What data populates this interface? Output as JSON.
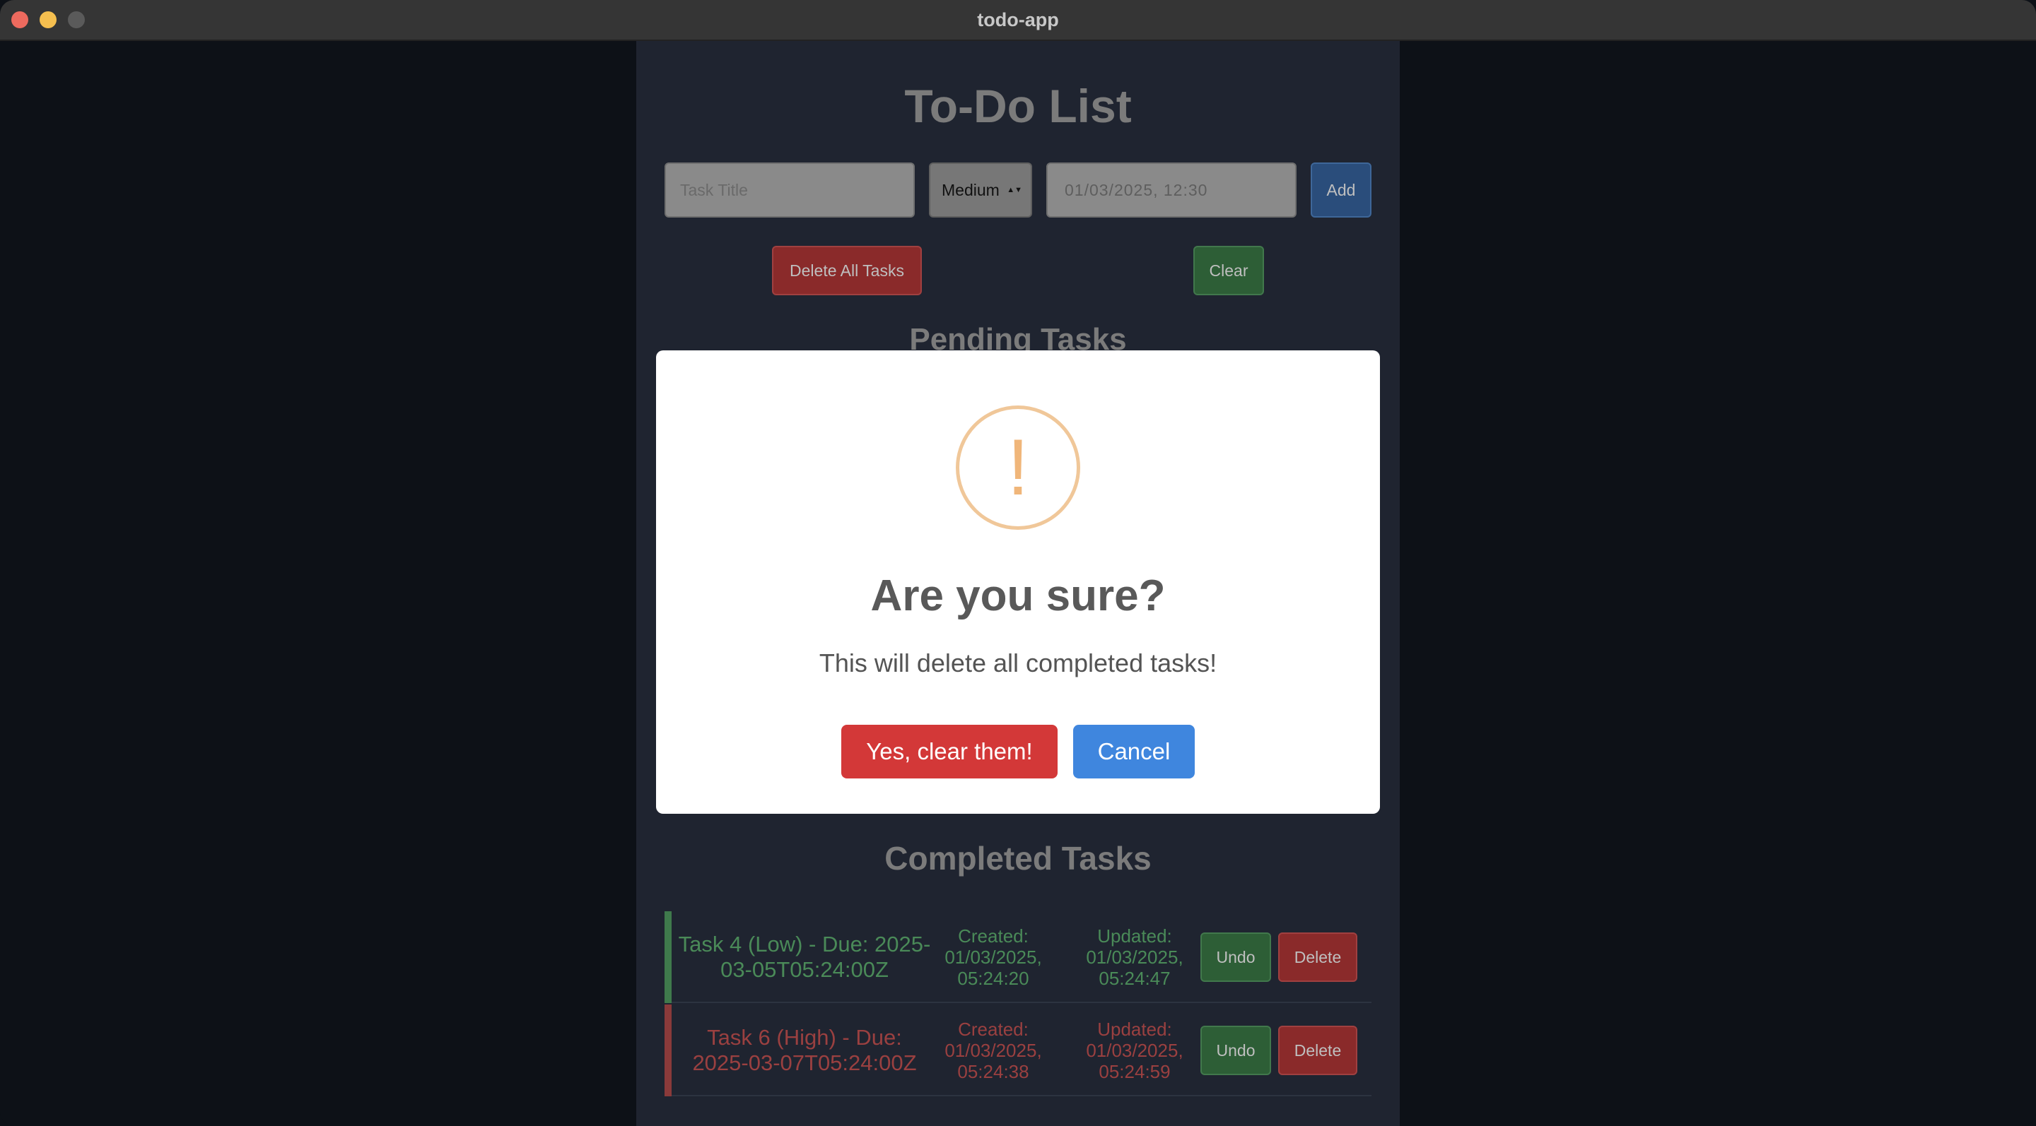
{
  "window": {
    "title": "todo-app"
  },
  "app": {
    "title": "To-Do List",
    "form": {
      "task_title_placeholder": "Task Title",
      "priority": "Medium",
      "due_datetime": "01/03/2025, 12:30",
      "add_label": "Add"
    },
    "actions": {
      "delete_all_label": "Delete All Tasks",
      "clear_label": "Clear"
    },
    "pending_heading": "Pending Tasks",
    "completed_heading": "Completed Tasks",
    "completed_tasks": [
      {
        "title": "Task 4 (Low) - Due: 2025-03-05T05:24:00Z",
        "priority": "Low",
        "created": "Created: 01/03/2025, 05:24:20",
        "updated": "Updated: 01/03/2025, 05:24:47",
        "undo_label": "Undo",
        "delete_label": "Delete",
        "color": "#4a8a58"
      },
      {
        "title": "Task 6 (High) - Due: 2025-03-07T05:24:00Z",
        "priority": "High",
        "created": "Created: 01/03/2025, 05:24:38",
        "updated": "Updated: 01/03/2025, 05:24:59",
        "undo_label": "Undo",
        "delete_label": "Delete",
        "color": "#9a4040"
      }
    ]
  },
  "modal": {
    "icon": "warning-icon",
    "icon_glyph": "!",
    "title": "Are you sure?",
    "text": "This will delete all completed tasks!",
    "confirm_label": "Yes, clear them!",
    "cancel_label": "Cancel"
  },
  "colors": {
    "confirm": "#d33838",
    "cancel": "#3f86de",
    "warning": "#f0c799"
  }
}
